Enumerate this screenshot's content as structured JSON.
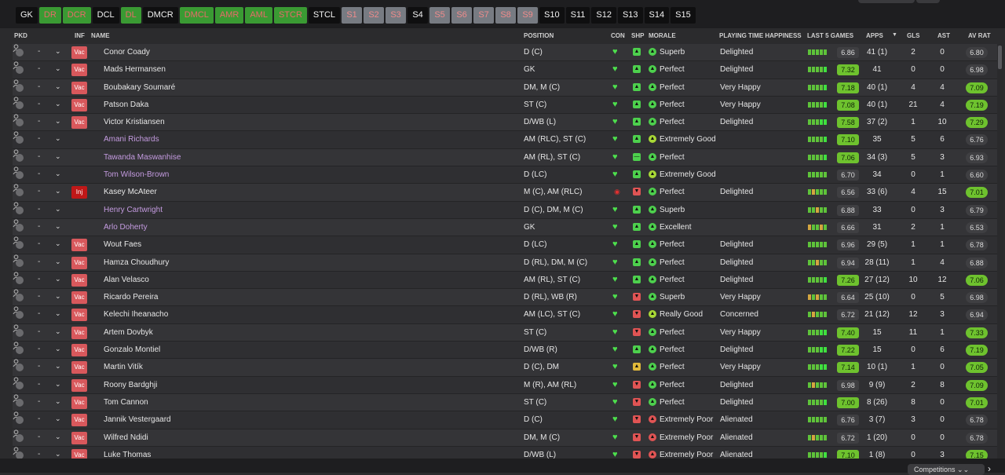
{
  "position_filters": [
    {
      "label": "GK",
      "style": "dark"
    },
    {
      "label": "DR",
      "style": "green"
    },
    {
      "label": "DCR",
      "style": "green"
    },
    {
      "label": "DCL",
      "style": "dark"
    },
    {
      "label": "DL",
      "style": "green"
    },
    {
      "label": "DMCR",
      "style": "dark"
    },
    {
      "label": "DMCL",
      "style": "green"
    },
    {
      "label": "AMR",
      "style": "green"
    },
    {
      "label": "AML",
      "style": "green"
    },
    {
      "label": "STCR",
      "style": "green"
    },
    {
      "label": "STCL",
      "style": "dark"
    },
    {
      "label": "S1",
      "style": "grey"
    },
    {
      "label": "S2",
      "style": "grey"
    },
    {
      "label": "S3",
      "style": "grey"
    },
    {
      "label": "S4",
      "style": "dark"
    },
    {
      "label": "S5",
      "style": "grey"
    },
    {
      "label": "S6",
      "style": "grey"
    },
    {
      "label": "S7",
      "style": "grey"
    },
    {
      "label": "S8",
      "style": "grey"
    },
    {
      "label": "S9",
      "style": "grey"
    },
    {
      "label": "S10",
      "style": "dark"
    },
    {
      "label": "S11",
      "style": "dark"
    },
    {
      "label": "S12",
      "style": "dark"
    },
    {
      "label": "S13",
      "style": "dark"
    },
    {
      "label": "S14",
      "style": "dark"
    },
    {
      "label": "S15",
      "style": "dark"
    }
  ],
  "headers": {
    "pkd": "PKD",
    "inf": "INF",
    "name": "NAME",
    "position": "POSITION",
    "con": "CON",
    "shp": "SHP",
    "morale": "MORALE",
    "playing_time": "PLAYING TIME HAPPINESS",
    "last5": "LAST 5 GAMES",
    "apps": "APPS",
    "sort_icon": "▼",
    "gls": "GLS",
    "ast": "AST",
    "av_rat": "AV RAT"
  },
  "players": [
    {
      "inf": "Vac",
      "name": "Conor Coady",
      "loan": false,
      "position": "D (C)",
      "shp": "up",
      "morale": "Superb",
      "happiness": "Delighted",
      "last5": [
        "g",
        "g",
        "g",
        "g",
        "g"
      ],
      "last5_avg": "6.86",
      "apps": "41 (1)",
      "gls": "2",
      "ast": "0",
      "av_rat": "6.80"
    },
    {
      "inf": "Vac",
      "name": "Mads Hermansen",
      "loan": false,
      "position": "GK",
      "shp": "up",
      "morale": "Perfect",
      "happiness": "Delighted",
      "last5": [
        "g",
        "g",
        "g",
        "g",
        "G"
      ],
      "last5_avg": "7.32",
      "apps": "41",
      "gls": "0",
      "ast": "0",
      "av_rat": "6.98"
    },
    {
      "inf": "Vac",
      "name": "Boubakary Soumaré",
      "loan": false,
      "position": "DM, M (C)",
      "shp": "up",
      "morale": "Perfect",
      "happiness": "Very Happy",
      "last5": [
        "g",
        "g",
        "g",
        "g",
        "G"
      ],
      "last5_avg": "7.18",
      "apps": "40 (1)",
      "gls": "4",
      "ast": "4",
      "av_rat": "7.09"
    },
    {
      "inf": "Vac",
      "name": "Patson Daka",
      "loan": false,
      "position": "ST (C)",
      "shp": "up",
      "morale": "Perfect",
      "happiness": "Very Happy",
      "last5": [
        "g",
        "g",
        "g",
        "g",
        "G"
      ],
      "last5_avg": "7.08",
      "apps": "40 (1)",
      "gls": "21",
      "ast": "4",
      "av_rat": "7.19"
    },
    {
      "inf": "Vac",
      "name": "Victor Kristiansen",
      "loan": false,
      "position": "D/WB (L)",
      "shp": "up",
      "morale": "Perfect",
      "happiness": "Delighted",
      "last5": [
        "g",
        "g",
        "g",
        "G",
        "G"
      ],
      "last5_avg": "7.58",
      "apps": "37 (2)",
      "gls": "1",
      "ast": "10",
      "av_rat": "7.29"
    },
    {
      "inf": "",
      "name": "Amani Richards",
      "loan": true,
      "position": "AM (RLC), ST (C)",
      "shp": "up",
      "morale": "Extremely Good",
      "happiness": "",
      "last5": [
        "g",
        "g",
        "g",
        "g",
        "G"
      ],
      "last5_avg": "7.10",
      "apps": "35",
      "gls": "5",
      "ast": "6",
      "av_rat": "6.76"
    },
    {
      "inf": "",
      "name": "Tawanda Maswanhise",
      "loan": true,
      "position": "AM (RL), ST (C)",
      "shp": "flat",
      "morale": "Perfect",
      "happiness": "",
      "last5": [
        "g",
        "g",
        "g",
        "g",
        "G"
      ],
      "last5_avg": "7.06",
      "apps": "34 (3)",
      "gls": "5",
      "ast": "3",
      "av_rat": "6.93"
    },
    {
      "inf": "",
      "name": "Tom Wilson-Brown",
      "loan": true,
      "position": "D (LC)",
      "shp": "up",
      "morale": "Extremely Good",
      "happiness": "",
      "last5": [
        "g",
        "g",
        "g",
        "g",
        "g"
      ],
      "last5_avg": "6.70",
      "apps": "34",
      "gls": "0",
      "ast": "1",
      "av_rat": "6.60"
    },
    {
      "inf": "Inj",
      "name": "Kasey McAteer",
      "loan": false,
      "position": "M (C), AM (RLC)",
      "shp": "down",
      "morale": "Perfect",
      "happiness": "Delighted",
      "last5": [
        "g",
        "y",
        "g",
        "g",
        "g"
      ],
      "last5_avg": "6.56",
      "apps": "33 (6)",
      "gls": "4",
      "ast": "15",
      "av_rat": "7.01"
    },
    {
      "inf": "",
      "name": "Henry Cartwright",
      "loan": true,
      "position": "D (C), DM, M (C)",
      "shp": "up",
      "morale": "Superb",
      "happiness": "",
      "last5": [
        "g",
        "g",
        "y",
        "g",
        "g"
      ],
      "last5_avg": "6.88",
      "apps": "33",
      "gls": "0",
      "ast": "3",
      "av_rat": "6.79"
    },
    {
      "inf": "",
      "name": "Arlo Doherty",
      "loan": true,
      "position": "GK",
      "shp": "up",
      "morale": "Excellent",
      "happiness": "",
      "last5": [
        "y",
        "g",
        "g",
        "y",
        "g"
      ],
      "last5_avg": "6.66",
      "apps": "31",
      "gls": "2",
      "ast": "1",
      "av_rat": "6.53"
    },
    {
      "inf": "Vac",
      "name": "Wout Faes",
      "loan": false,
      "position": "D (LC)",
      "shp": "up",
      "morale": "Perfect",
      "happiness": "Delighted",
      "last5": [
        "g",
        "g",
        "g",
        "g",
        "g"
      ],
      "last5_avg": "6.96",
      "apps": "29 (5)",
      "gls": "1",
      "ast": "1",
      "av_rat": "6.78"
    },
    {
      "inf": "Vac",
      "name": "Hamza Choudhury",
      "loan": false,
      "position": "D (RL), DM, M (C)",
      "shp": "up",
      "morale": "Perfect",
      "happiness": "Delighted",
      "last5": [
        "g",
        "g",
        "y",
        "g",
        "g"
      ],
      "last5_avg": "6.94",
      "apps": "28 (11)",
      "gls": "1",
      "ast": "4",
      "av_rat": "6.88"
    },
    {
      "inf": "Vac",
      "name": "Alan Velasco",
      "loan": false,
      "position": "AM (RL), ST (C)",
      "shp": "up",
      "morale": "Perfect",
      "happiness": "Delighted",
      "last5": [
        "g",
        "g",
        "g",
        "g",
        "G"
      ],
      "last5_avg": "7.26",
      "apps": "27 (12)",
      "gls": "10",
      "ast": "12",
      "av_rat": "7.06"
    },
    {
      "inf": "Vac",
      "name": "Ricardo Pereira",
      "loan": false,
      "position": "D (RL), WB (R)",
      "shp": "down",
      "morale": "Superb",
      "happiness": "Very Happy",
      "last5": [
        "y",
        "g",
        "y",
        "g",
        "g"
      ],
      "last5_avg": "6.64",
      "apps": "25 (10)",
      "gls": "0",
      "ast": "5",
      "av_rat": "6.98"
    },
    {
      "inf": "Vac",
      "name": "Kelechi Iheanacho",
      "loan": false,
      "position": "AM (LC), ST (C)",
      "shp": "down",
      "morale": "Really Good",
      "happiness": "Concerned",
      "last5": [
        "g",
        "y",
        "g",
        "g",
        "g"
      ],
      "last5_avg": "6.72",
      "apps": "21 (12)",
      "gls": "12",
      "ast": "3",
      "av_rat": "6.94"
    },
    {
      "inf": "Vac",
      "name": "Artem Dovbyk",
      "loan": false,
      "position": "ST (C)",
      "shp": "down",
      "morale": "Perfect",
      "happiness": "Very Happy",
      "last5": [
        "g",
        "g",
        "g",
        "G",
        "G"
      ],
      "last5_avg": "7.40",
      "apps": "15",
      "gls": "11",
      "ast": "1",
      "av_rat": "7.33"
    },
    {
      "inf": "Vac",
      "name": "Gonzalo Montiel",
      "loan": false,
      "position": "D/WB (R)",
      "shp": "up",
      "morale": "Perfect",
      "happiness": "Delighted",
      "last5": [
        "g",
        "g",
        "g",
        "G",
        "G"
      ],
      "last5_avg": "7.22",
      "apps": "15",
      "gls": "0",
      "ast": "6",
      "av_rat": "7.19"
    },
    {
      "inf": "Vac",
      "name": "Martin Vitík",
      "loan": false,
      "position": "D (C), DM",
      "shp": "warn",
      "morale": "Perfect",
      "happiness": "Very Happy",
      "last5": [
        "g",
        "g",
        "g",
        "G",
        "G"
      ],
      "last5_avg": "7.14",
      "apps": "10 (1)",
      "gls": "1",
      "ast": "0",
      "av_rat": "7.05"
    },
    {
      "inf": "Vac",
      "name": "Roony Bardghji",
      "loan": false,
      "position": "M (R), AM (RL)",
      "shp": "down",
      "morale": "Perfect",
      "happiness": "Delighted",
      "last5": [
        "g",
        "y",
        "g",
        "g",
        "g"
      ],
      "last5_avg": "6.98",
      "apps": "9 (9)",
      "gls": "2",
      "ast": "8",
      "av_rat": "7.09"
    },
    {
      "inf": "Vac",
      "name": "Tom Cannon",
      "loan": false,
      "position": "ST (C)",
      "shp": "down",
      "morale": "Perfect",
      "happiness": "Delighted",
      "last5": [
        "g",
        "g",
        "g",
        "g",
        "G"
      ],
      "last5_avg": "7.00",
      "apps": "8 (26)",
      "gls": "8",
      "ast": "0",
      "av_rat": "7.01"
    },
    {
      "inf": "Vac",
      "name": "Jannik Vestergaard",
      "loan": false,
      "position": "D (C)",
      "shp": "down",
      "morale": "Extremely Poor",
      "happiness": "Alienated",
      "last5": [
        "g",
        "g",
        "g",
        "g",
        "g"
      ],
      "last5_avg": "6.76",
      "apps": "3 (7)",
      "gls": "3",
      "ast": "0",
      "av_rat": "6.78"
    },
    {
      "inf": "Vac",
      "name": "Wilfred Ndidi",
      "loan": false,
      "position": "DM, M (C)",
      "shp": "down",
      "morale": "Extremely Poor",
      "happiness": "Alienated",
      "last5": [
        "g",
        "y",
        "g",
        "g",
        "g"
      ],
      "last5_avg": "6.72",
      "apps": "1 (20)",
      "gls": "0",
      "ast": "0",
      "av_rat": "6.78"
    },
    {
      "inf": "Vac",
      "name": "Luke Thomas",
      "loan": false,
      "position": "D/WB (L)",
      "shp": "down",
      "morale": "Extremely Poor",
      "happiness": "Alienated",
      "last5": [
        "g",
        "g",
        "g",
        "g",
        "G"
      ],
      "last5_avg": "7.10",
      "apps": "1 (8)",
      "gls": "0",
      "ast": "3",
      "av_rat": "7.15"
    }
  ],
  "footer": {
    "competitions_label": "Competitions"
  },
  "colors": {
    "green_badge": "#6ec22e",
    "dark_badge": "#3f3f42",
    "vac_badge": "#d8585c",
    "inj_badge": "#c01818",
    "loan_name": "#c49be0"
  }
}
